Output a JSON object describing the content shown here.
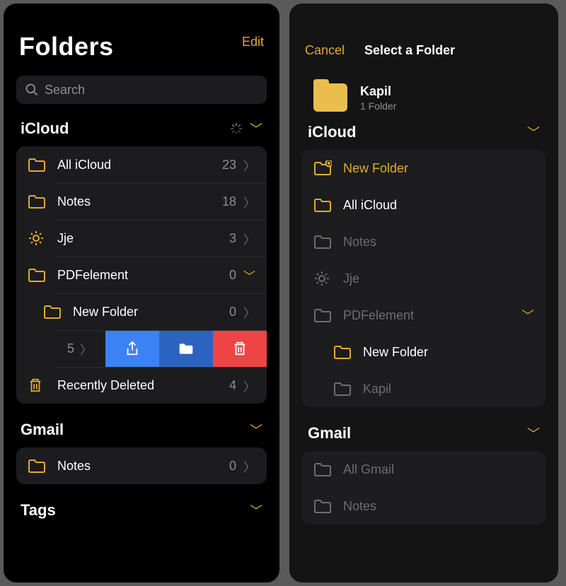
{
  "left": {
    "edit": "Edit",
    "title": "Folders",
    "search_placeholder": "Search",
    "sections": [
      {
        "name": "iCloud",
        "items": [
          {
            "icon": "folder",
            "label": "All iCloud",
            "count": "23",
            "disc": "chevron"
          },
          {
            "icon": "folder",
            "label": "Notes",
            "count": "18",
            "disc": "chevron"
          },
          {
            "icon": "gear",
            "label": "Jje",
            "count": "3",
            "disc": "chevron"
          },
          {
            "icon": "folder",
            "label": "PDFelement",
            "count": "0",
            "disc": "down"
          },
          {
            "icon": "folder",
            "label": "New Folder",
            "count": "0",
            "disc": "chevron",
            "indent": true
          },
          {
            "swipe": true,
            "count": "5"
          },
          {
            "icon": "trash",
            "label": "Recently Deleted",
            "count": "4",
            "disc": "chevron"
          }
        ]
      },
      {
        "name": "Gmail",
        "items": [
          {
            "icon": "folder",
            "label": "Notes",
            "count": "0",
            "disc": "chevron"
          }
        ]
      },
      {
        "name": "Tags",
        "items": []
      }
    ]
  },
  "right": {
    "cancel": "Cancel",
    "title": "Select a Folder",
    "subject": {
      "name": "Kapil",
      "sub": "1 Folder"
    },
    "sections": [
      {
        "name": "iCloud",
        "items": [
          {
            "icon": "folder-plus",
            "label": "New Folder",
            "state": "gold"
          },
          {
            "icon": "folder",
            "label": "All iCloud",
            "state": "enabled"
          },
          {
            "icon": "folder-mute",
            "label": "Notes",
            "state": "disabled"
          },
          {
            "icon": "gear-mute",
            "label": "Jje",
            "state": "disabled"
          },
          {
            "icon": "folder-mute",
            "label": "PDFelement",
            "state": "disabled",
            "chev": true
          },
          {
            "icon": "folder",
            "label": "New Folder",
            "state": "enabled",
            "indent": true
          },
          {
            "icon": "folder-mute",
            "label": "Kapil",
            "state": "disabled",
            "indent": true
          }
        ]
      },
      {
        "name": "Gmail",
        "items": [
          {
            "icon": "folder-mute",
            "label": "All Gmail",
            "state": "disabled"
          },
          {
            "icon": "folder-mute",
            "label": "Notes",
            "state": "disabled"
          }
        ]
      }
    ]
  }
}
